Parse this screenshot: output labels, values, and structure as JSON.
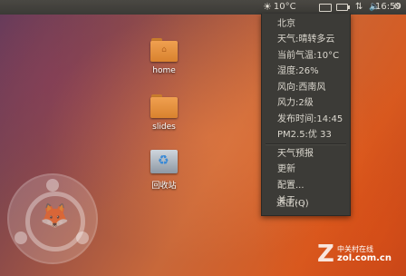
{
  "panel": {
    "weather_temp": "10°C",
    "time": "16:59"
  },
  "weather_menu": {
    "items": [
      "北京",
      "天气:晴转多云",
      "当前气温:10°C",
      "湿度:26%",
      "风向:西南风",
      "风力:2级",
      "发布时间:14:45",
      "PM2.5:优 33"
    ],
    "actions": [
      "天气预报",
      "更新",
      "配置...",
      "关于...",
      "退出(Q)"
    ]
  },
  "desktop": {
    "icons": [
      {
        "label": "home",
        "icon": "folder-icon"
      },
      {
        "label": "slides",
        "icon": "folder-icon"
      },
      {
        "label": "回收站",
        "icon": "trash-icon"
      }
    ]
  },
  "watermark": {
    "cn": "中关村在线",
    "en": "zol.com.cn"
  }
}
